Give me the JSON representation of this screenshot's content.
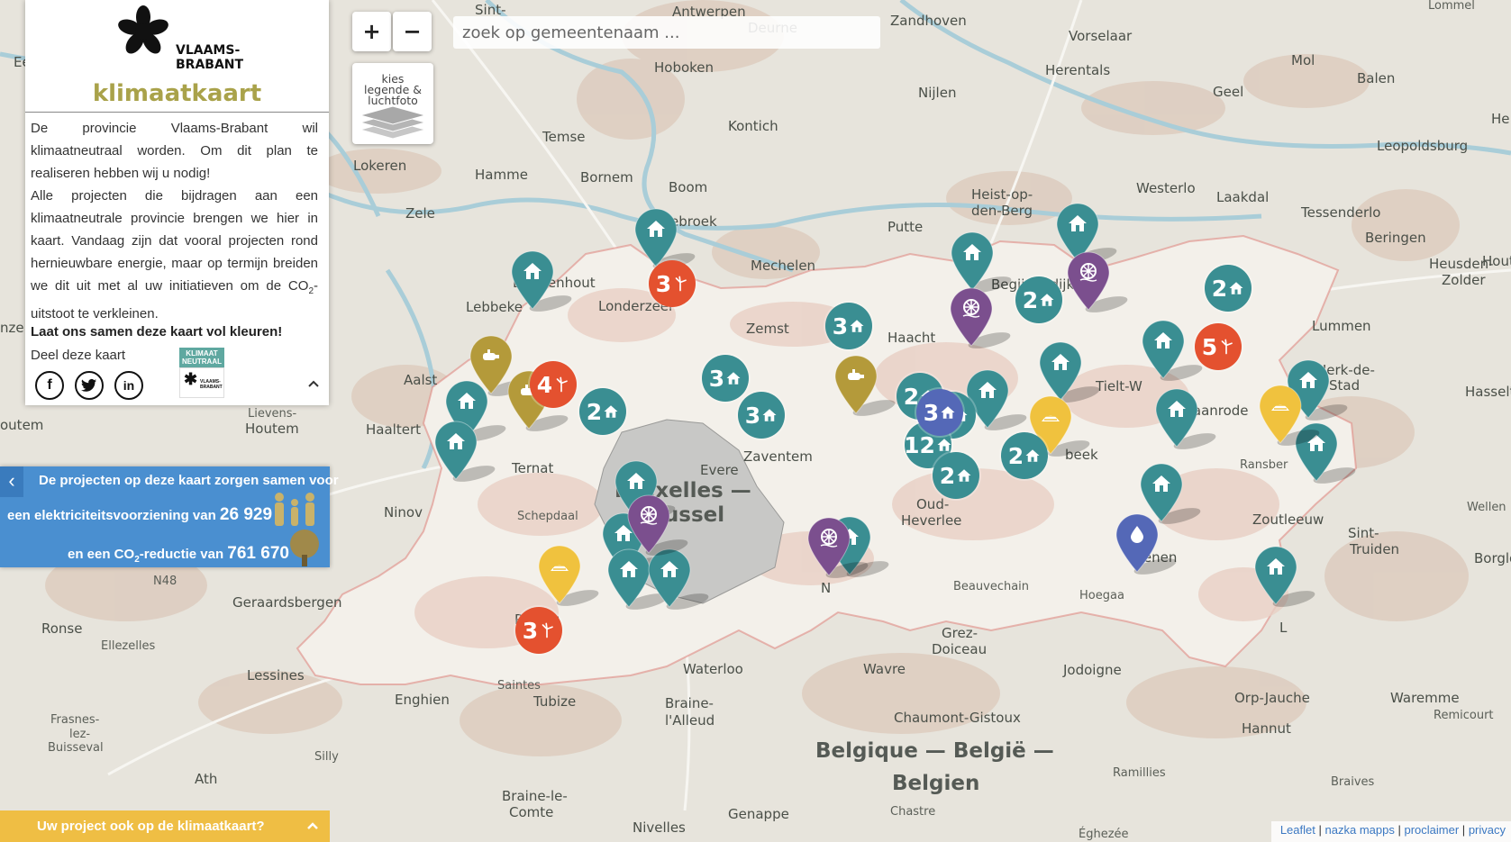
{
  "colors": {
    "water": "#a9cdd8",
    "land": "#e7e4dc",
    "province": "#f3f0ea",
    "brussels": "#c8c8c6",
    "teal": "#3a8e92",
    "orange": "#e4512f",
    "olive": "#b49a3a",
    "purple": "#7b4f8e",
    "blue": "#5468b7",
    "yellow": "#f0c23e",
    "panelTitle": "#a9a24a",
    "stats": "#4a8fd0",
    "bottomBar": "#efbe44"
  },
  "logo": {
    "line1": "VLAAMS-",
    "line2": "BRABANT",
    "title": "klimaatkaart"
  },
  "intro": {
    "p1": "De provincie Vlaams-Brabant wil klimaatneutraal worden. Om dit plan te realiseren hebben wij u nodig!",
    "p2_pre": "Alle projecten die bijdragen aan een klimaatneutrale provincie brengen we hier in kaart. Vandaag zijn dat vooral projecten rond hernieuwbare energie, maar op termijn breiden we dit uit met al uw initiatieven om de CO",
    "p2_sub": "2",
    "p2_post": "-uitstoot te verkleinen.",
    "cta": "Laat ons samen deze kaart vol kleuren!",
    "share": "Deel deze kaart",
    "social": [
      "facebook-icon",
      "twitter-icon",
      "linkedin-icon"
    ],
    "badge": {
      "l1": "KLIMAAT",
      "l2": "NEUTRAAL",
      "l3": "VLAAMS-",
      "l4": "BRABANT"
    }
  },
  "stats": {
    "line1": "De projecten op deze kaart zorgen samen voor",
    "line2_pre": "een elektriciteitsvoorziening van",
    "line2_num": "26 929",
    "line3_pre": "en een CO",
    "line3_sub": "2",
    "line3_mid": "-reductie van",
    "line3_num": "761 670"
  },
  "controls": {
    "zoom_in": "+",
    "zoom_out": "−",
    "layers": [
      "kies",
      "legende &",
      "luchtfoto"
    ],
    "search_placeholder": "zoek op gemeentenaam ..."
  },
  "bottom_bar": {
    "label": "Uw project ook op de klimaatkaart?",
    "chevron": "^"
  },
  "attribution": {
    "leaflet": "Leaflet",
    "nazka": "nazka mapps",
    "proclaimer": "proclaimer",
    "privacy": "privacy",
    "sep": "|"
  },
  "places": {
    "sint": "Sint-",
    "antwerpen": "Antwerpen",
    "zandhoven": "Zandhoven",
    "vorselaar": "Vorselaar",
    "lommel": "Lommel",
    "eeklo": "Eeklo",
    "deurne": "Deurne",
    "mol": "Mol",
    "herentals": "Herentals",
    "balen": "Balen",
    "hoboken": "Hoboken",
    "nijlen": "Nijlen",
    "geel": "Geel",
    "kontich": "Kontich",
    "temse": "Temse",
    "leopoldsburg": "Leopoldsburg",
    "he": "He",
    "lokeren": "Lokeren",
    "hamme": "Hamme",
    "bornem": "Bornem",
    "boom": "Boom",
    "westerlo": "Westerlo",
    "laakdal": "Laakdal",
    "heistop": "Heist-op-",
    "denberg": "den-Berg",
    "zele": "Zele",
    "putte": "Putte",
    "tessenderlo": "Tessenderlo",
    "willebroek": "Willebroek",
    "beringen": "Beringen",
    "heusden": "Heusden-",
    "zolder": "Zolder",
    "hout": "Hout",
    "mechelen": "Mechelen",
    "buggenhout": "Buggenhout",
    "londerzeel": "Londerzeel",
    "lebbeke": "Lebbeke",
    "zemst": "Zemst",
    "haacht": "Haacht",
    "begijnendijk": "Begijnendijk",
    "lummen": "Lummen",
    "herkdelastad1": "Herk-de-",
    "herkdelastad2": "Stad",
    "hasselt": "Hasselt",
    "nze": "nze",
    "aalst": "Aalst",
    "tielt": "Tielt-W",
    "waanrode": "Waanrode",
    "outem": "outem",
    "lievens1": "Lievens-",
    "lievens2": "Houtem",
    "haaltert": "Haaltert",
    "ternat": "Ternat",
    "evere": "Evere",
    "zaventem": "Zaventem",
    "beek": "beek",
    "ransberg": "Ransber",
    "bruxelles": "Bruxelles —",
    "brussel": "Brussel",
    "ninove": "Ninov",
    "schepdaal": "Schepdaal",
    "oud1": "Oud-",
    "oud2": "Heverlee",
    "zoutleeuw": "Zoutleeuw",
    "wellen": "Wellen",
    "sinttruiden1": "Sint-",
    "sinttruiden2": "Truiden",
    "tienen": "Tienen",
    "borgloon": "Borgloo",
    "n48": "N48",
    "geraardsbergen": "Geraardsbergen",
    "beauvechain": "Beauvechain",
    "hoegaarden": "Hoegaa",
    "pepingen": "Peping",
    "ronse": "Ronse",
    "ellezelles": "Ellezelles",
    "grez1": "Grez-",
    "grez2": "Doiceau",
    "landen": "L",
    "lessines": "Lessines",
    "waterloo": "Waterloo",
    "wavre": "Wavre",
    "jodoigne": "Jodoigne",
    "orpjauche": "Orp-Jauche",
    "waremme": "Waremme",
    "saintes": "Saintes",
    "enghien": "Enghien",
    "tubize": "Tubize",
    "brainealleud1": "Braine-",
    "brainealleud2": "l'Alleud",
    "chaumont": "Chaumont-Gistoux",
    "hannut": "Hannut",
    "remicourt": "Remicourt",
    "frasnes1": "Frasnes-",
    "frasnes2": "lez-",
    "frasnes3": "Buisseval",
    "belgique1": "Belgique — België —",
    "belgique2": "Belgien",
    "silly": "Silly",
    "ath": "Ath",
    "braineleComte1": "Braine-le-",
    "braineleComte2": "Comte",
    "ramillies": "Ramillies",
    "braives": "Braives",
    "genappe": "Genappe",
    "chastre": "Chastre",
    "nivelles": "Nivelles",
    "eghezee": "Éghezée",
    "n": "N",
    "h": "H"
  },
  "markers": [
    {
      "type": "house",
      "color": "teal"
    },
    {
      "type": "house",
      "color": "teal"
    },
    {
      "type": "house",
      "color": "teal"
    },
    {
      "type": "house",
      "color": "teal"
    },
    {
      "type": "house",
      "color": "teal"
    },
    {
      "type": "house",
      "color": "teal"
    },
    {
      "type": "house",
      "color": "teal"
    },
    {
      "type": "house",
      "color": "teal"
    },
    {
      "type": "house",
      "color": "teal"
    },
    {
      "type": "house",
      "color": "teal"
    },
    {
      "type": "house",
      "color": "teal"
    },
    {
      "type": "house",
      "color": "teal"
    },
    {
      "type": "house",
      "color": "teal"
    },
    {
      "type": "house",
      "color": "teal"
    },
    {
      "type": "house",
      "color": "teal"
    },
    {
      "type": "house",
      "color": "teal"
    },
    {
      "type": "house",
      "color": "teal"
    },
    {
      "type": "house",
      "color": "teal"
    },
    {
      "type": "house",
      "color": "teal"
    },
    {
      "type": "biogas",
      "color": "olive"
    },
    {
      "type": "biogas",
      "color": "olive"
    },
    {
      "type": "biogas",
      "color": "olive"
    },
    {
      "type": "hydro",
      "color": "purple"
    },
    {
      "type": "hydro",
      "color": "purple"
    },
    {
      "type": "hydro",
      "color": "purple"
    },
    {
      "type": "hydro",
      "color": "purple"
    },
    {
      "type": "sun",
      "color": "yellow"
    },
    {
      "type": "sun",
      "color": "yellow"
    },
    {
      "type": "sun",
      "color": "yellow"
    },
    {
      "type": "drop",
      "color": "blue"
    }
  ],
  "clusters": [
    {
      "count": "3",
      "type": "wind",
      "color": "orange"
    },
    {
      "count": "5",
      "type": "wind",
      "color": "orange"
    },
    {
      "count": "4",
      "type": "wind",
      "color": "orange"
    },
    {
      "count": "3",
      "type": "wind",
      "color": "orange"
    },
    {
      "count": "2",
      "type": "house",
      "color": "teal"
    },
    {
      "count": "2",
      "type": "house",
      "color": "teal"
    },
    {
      "count": "3",
      "type": "house",
      "color": "teal"
    },
    {
      "count": "3",
      "type": "house",
      "color": "teal"
    },
    {
      "count": "3",
      "type": "house",
      "color": "teal"
    },
    {
      "count": "2",
      "type": "house",
      "color": "teal"
    },
    {
      "count": "2",
      "type": "house",
      "color": "teal"
    },
    {
      "count": "12",
      "type": "house",
      "color": "teal"
    },
    {
      "count": "2",
      "type": "house",
      "color": "teal"
    },
    {
      "count": "2",
      "type": "house",
      "color": "teal"
    },
    {
      "count": "2",
      "type": "house",
      "color": "teal"
    },
    {
      "count": "3",
      "type": "house",
      "color": "blue"
    }
  ]
}
